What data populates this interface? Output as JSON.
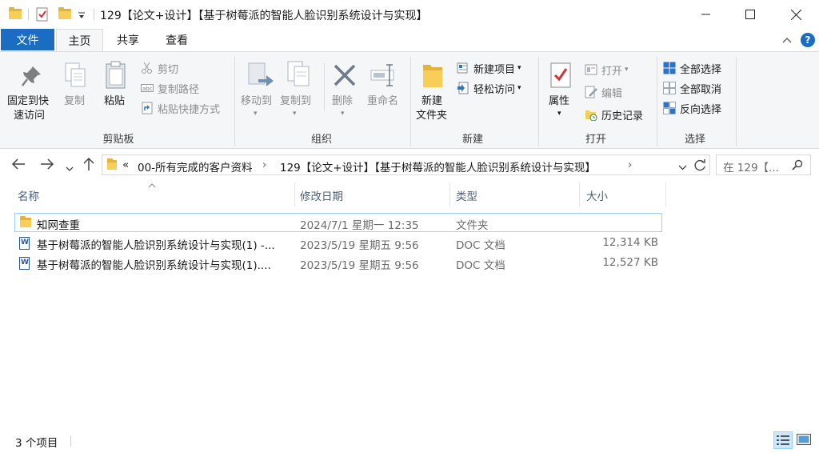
{
  "window": {
    "title": "129【论文+设计】【基于树莓派的智能人脸识别系统设计与实现】"
  },
  "ribbon_tabs": {
    "file": "文件",
    "home": "主页",
    "share": "共享",
    "view": "查看"
  },
  "clipboard": {
    "pin": "固定到快",
    "pin2": "速访问",
    "copy": "复制",
    "paste": "粘贴",
    "cut": "剪切",
    "copy_path": "复制路径",
    "paste_shortcut": "粘贴快捷方式",
    "label": "剪贴板"
  },
  "organize": {
    "move_to": "移动到",
    "copy_to": "复制到",
    "delete": "删除",
    "rename": "重命名",
    "label": "组织"
  },
  "new": {
    "new_folder": "新建",
    "new_folder2": "文件夹",
    "new_item": "新建项目",
    "easy_access": "轻松访问",
    "label": "新建"
  },
  "open": {
    "properties": "属性",
    "open": "打开",
    "edit": "编辑",
    "history": "历史记录",
    "label": "打开"
  },
  "select": {
    "select_all": "全部选择",
    "select_none": "全部取消",
    "invert": "反向选择",
    "label": "选择"
  },
  "address": {
    "prefix": "«",
    "crumb1": "00-所有完成的客户资料",
    "crumb2": "129【论文+设计】【基于树莓派的智能人脸识别系统设计与实现】",
    "search_placeholder": "在 129【..."
  },
  "columns": {
    "name": "名称",
    "date": "修改日期",
    "type": "类型",
    "size": "大小"
  },
  "files": [
    {
      "name": "知网查重",
      "date": "2024/7/1 星期一 12:35",
      "type": "文件夹",
      "size": "",
      "icon": "folder-icon"
    },
    {
      "name": "基于树莓派的智能人脸识别系统设计与实现(1) -...",
      "date": "2023/5/19 星期五 9:56",
      "type": "DOC 文档",
      "size": "12,314 KB",
      "icon": "word-doc-icon"
    },
    {
      "name": "基于树莓派的智能人脸识别系统设计与实现(1)....",
      "date": "2023/5/19 星期五 9:56",
      "type": "DOC 文档",
      "size": "12,527 KB",
      "icon": "word-doc-icon"
    }
  ],
  "status": {
    "count": "3 个项目"
  },
  "colors": {
    "accent": "#1b6dc4",
    "folder": "#f7cf58",
    "selection_border": "#99d1ff",
    "header_text": "#4c607a"
  }
}
